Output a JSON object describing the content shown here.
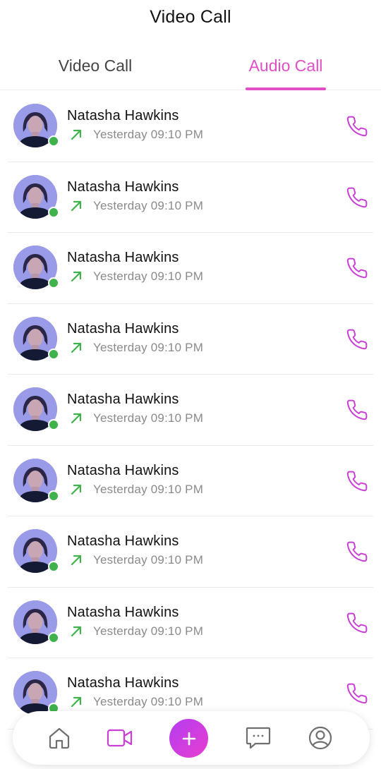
{
  "header": {
    "title": "Video Call"
  },
  "tabs": [
    {
      "label": "Video Call",
      "active": false
    },
    {
      "label": "Audio Call",
      "active": true
    }
  ],
  "colors": {
    "accent": "#e04fc5",
    "online": "#3fb24b",
    "outgoing_arrow": "#3fb24b",
    "call_icon": "#c93fd6"
  },
  "calls": [
    {
      "name": "Natasha Hawkins",
      "time": "Yesterday 09:10 PM",
      "direction_icon": "outgoing-arrow-icon",
      "online": true
    },
    {
      "name": "Natasha Hawkins",
      "time": "Yesterday 09:10 PM",
      "direction_icon": "outgoing-arrow-icon",
      "online": true
    },
    {
      "name": "Natasha Hawkins",
      "time": "Yesterday 09:10 PM",
      "direction_icon": "outgoing-arrow-icon",
      "online": true
    },
    {
      "name": "Natasha Hawkins",
      "time": "Yesterday 09:10 PM",
      "direction_icon": "outgoing-arrow-icon",
      "online": true
    },
    {
      "name": "Natasha Hawkins",
      "time": "Yesterday 09:10 PM",
      "direction_icon": "outgoing-arrow-icon",
      "online": true
    },
    {
      "name": "Natasha Hawkins",
      "time": "Yesterday 09:10 PM",
      "direction_icon": "outgoing-arrow-icon",
      "online": true
    },
    {
      "name": "Natasha Hawkins",
      "time": "Yesterday 09:10 PM",
      "direction_icon": "outgoing-arrow-icon",
      "online": true
    },
    {
      "name": "Natasha Hawkins",
      "time": "Yesterday 09:10 PM",
      "direction_icon": "outgoing-arrow-icon",
      "online": true
    },
    {
      "name": "Natasha Hawkins",
      "time": "Yesterday 09:10 PM",
      "direction_icon": "outgoing-arrow-icon",
      "online": true
    }
  ],
  "bottom_nav": [
    {
      "icon": "home-icon",
      "active": false
    },
    {
      "icon": "video-camera-icon",
      "active": true
    },
    {
      "icon": "plus-icon",
      "active": false
    },
    {
      "icon": "chat-bubble-icon",
      "active": false
    },
    {
      "icon": "user-profile-icon",
      "active": false
    }
  ]
}
